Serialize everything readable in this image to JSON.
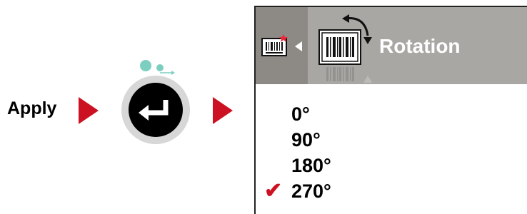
{
  "apply": {
    "label": "Apply"
  },
  "screen": {
    "title": "Rotation",
    "options": [
      {
        "label": "0°",
        "selected": false
      },
      {
        "label": "90°",
        "selected": false
      },
      {
        "label": "180°",
        "selected": false
      },
      {
        "label": "270°",
        "selected": true
      }
    ],
    "check_mark": "✔"
  },
  "colors": {
    "accent_red": "#cc1222",
    "header_gray": "#a9a7a4",
    "header_dark_gray": "#8d8a86",
    "indicator_teal": "#7ccfc0"
  },
  "icons": {
    "enter": "enter-icon",
    "label_small": "label-print-icon",
    "barcode_rotate": "barcode-rotate-icon"
  }
}
